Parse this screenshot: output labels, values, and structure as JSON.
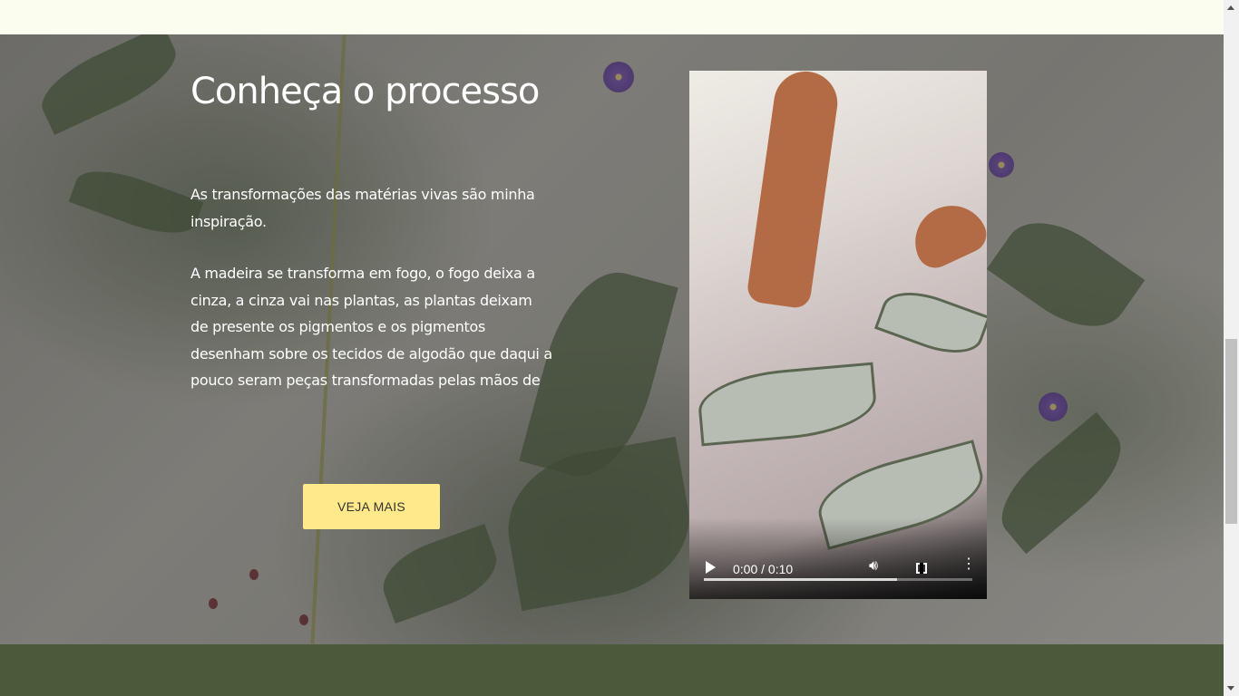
{
  "section": {
    "title": "Conheça o processo",
    "paragraph_1": "As transformações das matérias vivas são minha inspiração.",
    "paragraph_2": "A madeira se transforma em fogo, o fogo deixa a cinza, a cinza vai nas plantas, as plantas deixam de presente os pigmentos e os pigmentos desenham sobre os tecidos de algodão que daqui a pouco seram peças transformadas pelas mãos de",
    "cta_label": "VEJA MAIS"
  },
  "video": {
    "time_display": "0:00 / 0:10",
    "progress_buffered": 0.72,
    "icons": {
      "play": "play-icon",
      "volume": "volume-icon",
      "fullscreen": "fullscreen-icon",
      "menu": "more-options-icon"
    }
  },
  "colors": {
    "page_background": "#fbfdee",
    "cta_background": "#ffe98a",
    "footer_green": "#4b5a3a",
    "title_text": "#ffffff"
  }
}
